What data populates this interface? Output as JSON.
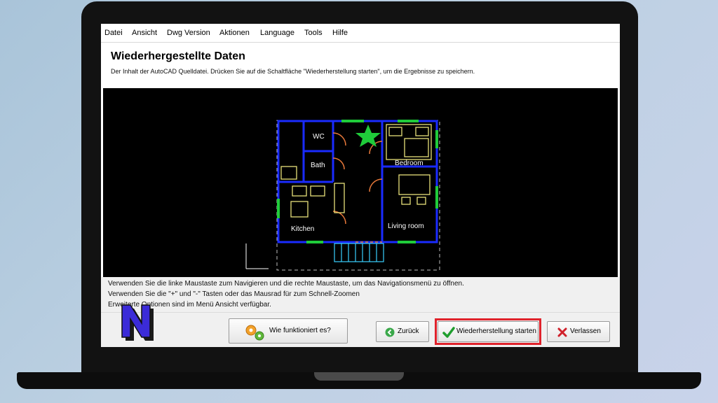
{
  "menu": [
    "Datei",
    "Ansicht",
    "Dwg Version",
    "Aktionen",
    "Language",
    "Tools",
    "Hilfe"
  ],
  "header": {
    "title": "Wiederhergestellte Daten",
    "subtitle": "Der Inhalt der AutoCAD Quelldatei. Drücken Sie auf die Schaltfläche \"Wiederherstellung starten\", um die Ergebnisse zu speichern."
  },
  "drawing": {
    "rooms": [
      "WC",
      "Bath",
      "Bedroom",
      "Kitchen",
      "Living room"
    ]
  },
  "hints": [
    "Verwenden Sie die linke Maustaste zum Navigieren und die rechte Maustaste, um das Navigationsmenü zu öffnen.",
    "Verwenden Sie die \"+\" und \"-\" Tasten oder das Mausrad für zum Schnell-Zoomen",
    "Erweiterte Optionen sind im Menü Ansicht verfügbar."
  ],
  "buttons": {
    "how": "Wie funktioniert es?",
    "back": "Zurück",
    "start": "Wiederherstellung starten",
    "exit": "Verlassen"
  },
  "icons": {
    "how": "gears-icon",
    "back": "back-arrow-icon",
    "start": "checkmark-icon",
    "exit": "close-x-icon",
    "logo": "n-logo-icon"
  },
  "colors": {
    "highlight": "#e0222b",
    "wall": "#1a2bff",
    "furniture": "#e8e07a",
    "door": "#e8793a",
    "window": "#1fcc3a",
    "logo": "#3b2bd8"
  }
}
